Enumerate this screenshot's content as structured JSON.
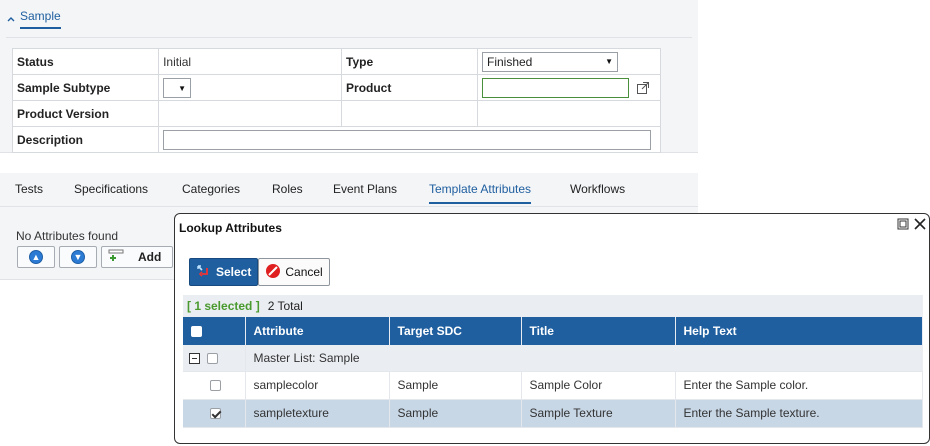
{
  "sample": {
    "section_title": "Sample",
    "fields": {
      "status_label": "Status",
      "status_value": "Initial",
      "type_label": "Type",
      "type_value": "Finished",
      "subtype_label": "Sample Subtype",
      "subtype_value": "",
      "product_label": "Product",
      "product_value": "",
      "product_version_label": "Product Version",
      "product_version_value": "",
      "description_label": "Description",
      "description_value": ""
    }
  },
  "tabs": [
    {
      "label": "Tests"
    },
    {
      "label": "Specifications"
    },
    {
      "label": "Categories"
    },
    {
      "label": "Roles"
    },
    {
      "label": "Event Plans"
    },
    {
      "label": "Template Attributes",
      "active": true
    },
    {
      "label": "Workflows"
    }
  ],
  "attributes_panel": {
    "empty_text": "No Attributes found",
    "add_label": "Add"
  },
  "dialog": {
    "title": "Lookup Attributes",
    "select_label": "Select",
    "cancel_label": "Cancel",
    "selected_count": "[ 1 selected ]",
    "total_text": "2 Total",
    "columns": [
      "Attribute",
      "Target SDC",
      "Title",
      "Help Text"
    ],
    "group_label": "Master List: Sample",
    "rows": [
      {
        "attribute": "samplecolor",
        "target_sdc": "Sample",
        "title": "Sample Color",
        "help_text": "Enter the Sample color.",
        "selected": false
      },
      {
        "attribute": "sampletexture",
        "target_sdc": "Sample",
        "title": "Sample Texture",
        "help_text": "Enter the Sample texture.",
        "selected": true
      }
    ]
  },
  "colors": {
    "accent": "#1f5fa0",
    "selected_count": "#4a9a30",
    "selected_row": "#c8d7e6",
    "panel_bg": "#f4f5f7"
  }
}
